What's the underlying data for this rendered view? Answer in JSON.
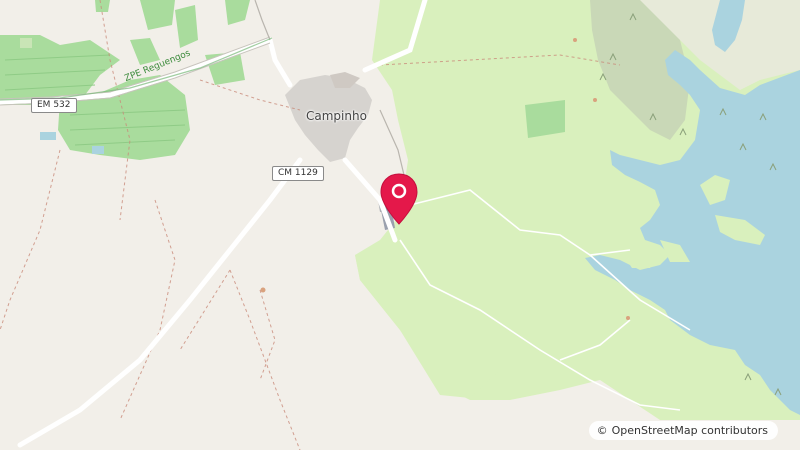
{
  "map": {
    "place_label": "Campinho",
    "road_labels": {
      "em532": "EM 532",
      "cm1129": "CM 1129",
      "zpe": "ZPE Reguengos"
    },
    "marker": {
      "name": "location-pin",
      "color": "#e4184a"
    },
    "attribution": {
      "symbol": "©",
      "text": "OpenStreetMap contributors"
    },
    "colors": {
      "land": "#f2efe9",
      "meadow": "#d9f0bd",
      "vineyard": "#a9dc9d",
      "water": "#aad3df",
      "town": "#d6d3cf",
      "scrub": "#c9d8b7"
    }
  }
}
